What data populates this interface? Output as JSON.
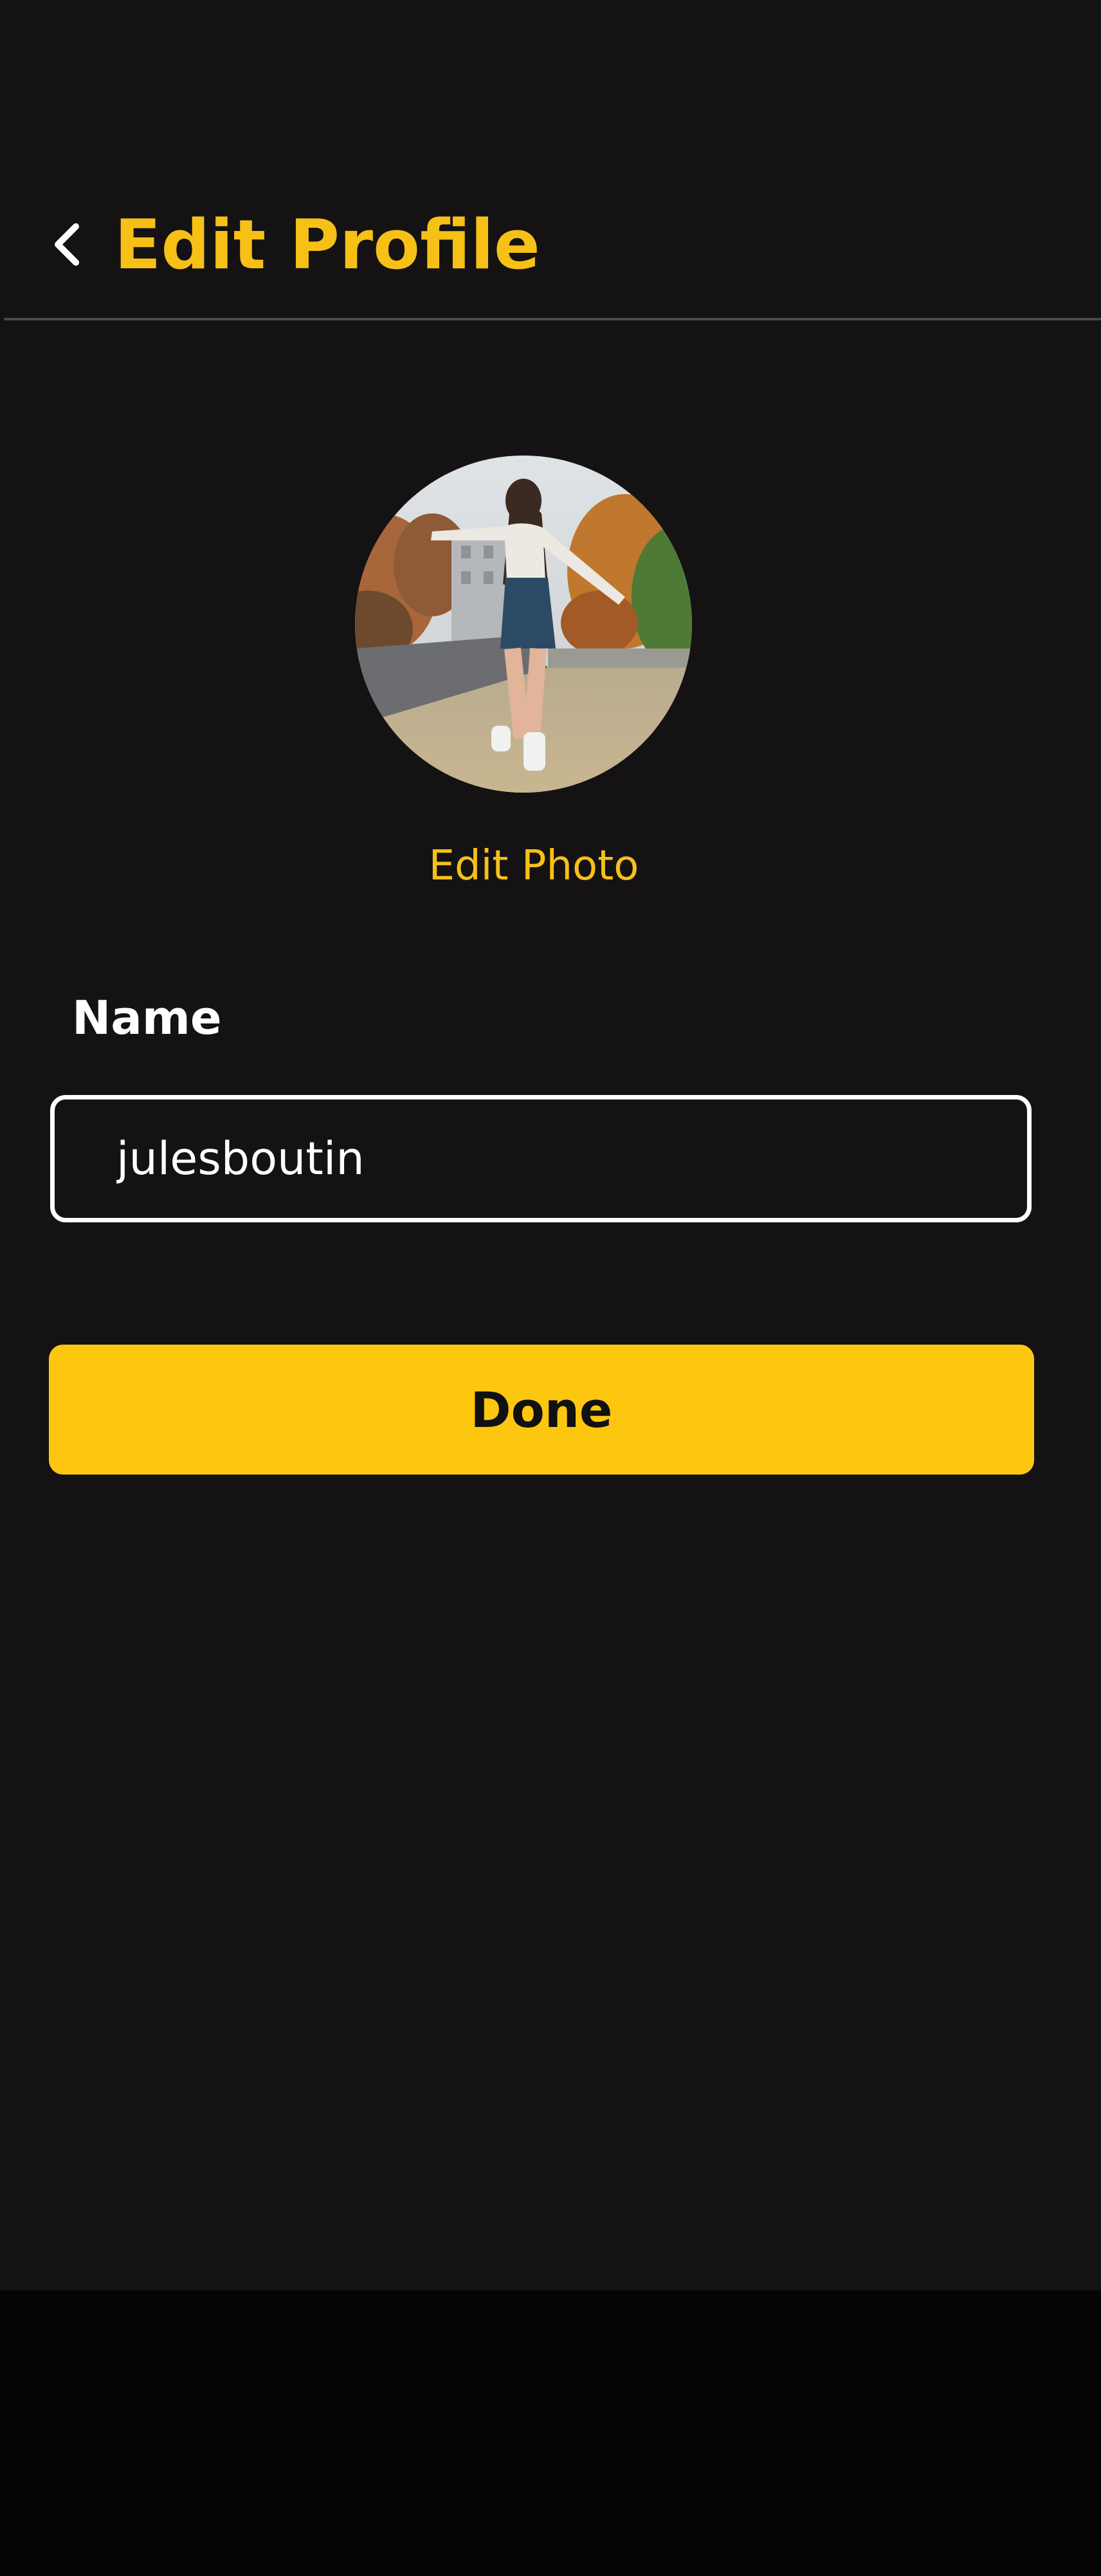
{
  "header": {
    "back_icon": "chevron-left-icon",
    "title": "Edit Profile"
  },
  "avatar": {
    "description_icon": "profile-photo",
    "edit_label": "Edit Photo"
  },
  "form": {
    "name_label": "Name",
    "name_value": "julesboutin"
  },
  "actions": {
    "done_label": "Done"
  },
  "colors": {
    "accent": "#F6C017",
    "button": "#FDC70F",
    "background": "#141213",
    "bottom_bar": "#040404"
  }
}
